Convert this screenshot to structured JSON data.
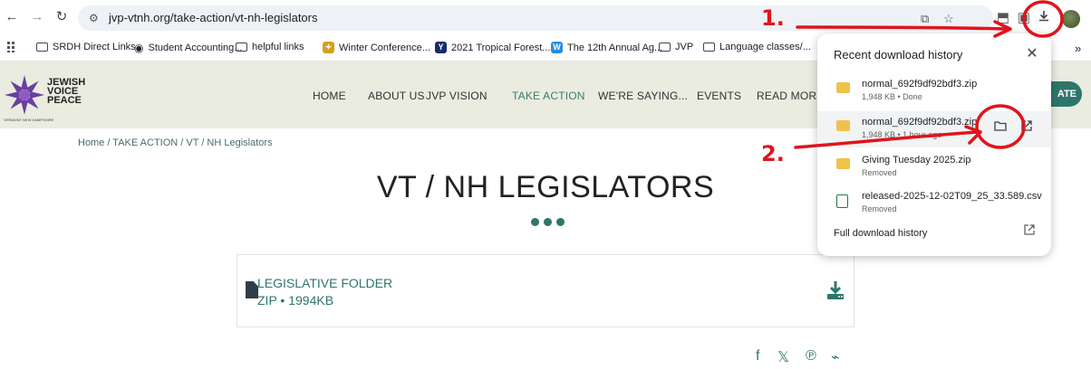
{
  "browser": {
    "url": "jvp-vtnh.org/take-action/vt-nh-legislators",
    "icons": [
      "back-icon",
      "forward-icon",
      "reload-icon",
      "site-settings-icon",
      "install-icon",
      "star-icon",
      "extensions-icon",
      "tab-groups-icon",
      "download-icon",
      "profile-avatar"
    ]
  },
  "bookmarks": [
    {
      "label": "SRDH Direct Links",
      "icon": "folder"
    },
    {
      "label": "Student Accounting...",
      "icon": "globe"
    },
    {
      "label": "helpful links",
      "icon": "folder"
    },
    {
      "label": "Winter Conference...",
      "icon": "favicon"
    },
    {
      "label": "2021 Tropical Forest...",
      "icon": "favicon"
    },
    {
      "label": "The 12th Annual Ag...",
      "icon": "favicon"
    },
    {
      "label": "JVP",
      "icon": "folder"
    },
    {
      "label": "Language classes/...",
      "icon": "folder"
    }
  ],
  "site": {
    "logo_lines": [
      "JEWISH",
      "VOICE",
      "PEACE"
    ],
    "logo_sub": "VERMONT NEW HAMPSHIRE",
    "menu": [
      "HOME",
      "ABOUT US",
      "JVP VISION",
      "TAKE ACTION",
      "WE'RE SAYING...",
      "EVENTS",
      "READ MORE"
    ],
    "active_menu": "TAKE ACTION",
    "donate_label": "ATE",
    "accent_color": "#2e766b"
  },
  "page": {
    "breadcrumb": "Home /  TAKE ACTION  /  VT / NH Legislators",
    "title": "VT / NH LEGISLATORS",
    "file": {
      "name": "LEGISLATIVE FOLDER",
      "meta": "ZIP • 1994KB"
    },
    "social_icons": [
      "facebook-icon",
      "x-icon",
      "pinterest-icon",
      "rss-icon"
    ]
  },
  "downloads": {
    "title": "Recent download history",
    "items": [
      {
        "name": "normal_692f9df92bdf3.zip",
        "sub": "1,948 KB • Done",
        "type": "zip"
      },
      {
        "name": "normal_692f9df92bdf3.zip",
        "sub": "1,948 KB • 1 hour ago",
        "type": "zip"
      },
      {
        "name": "Giving Tuesday 2025.zip",
        "sub": "Removed",
        "type": "zip"
      },
      {
        "name": "released-2025-12-02T09_25_33.589.csv",
        "sub": "Removed",
        "type": "csv"
      }
    ],
    "footer": "Full download history"
  },
  "annotations": {
    "step1": "1.",
    "step2": "2.",
    "color": "#e0141c"
  }
}
